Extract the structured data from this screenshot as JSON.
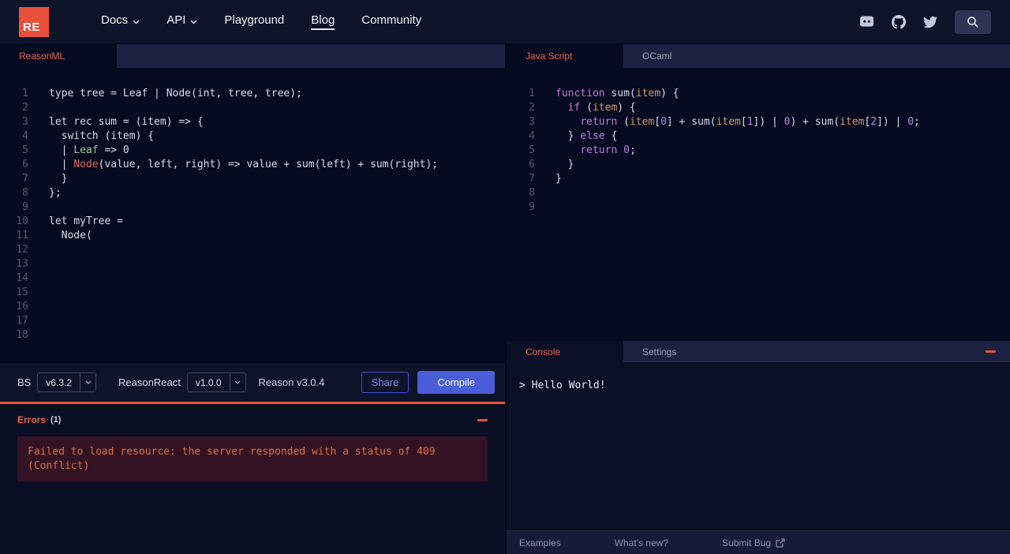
{
  "colors": {
    "accent_red": "#e8503a",
    "tab_red": "#e8604c",
    "button_blue": "#4a5dd8",
    "editor_bg": "#060a20"
  },
  "navbar": {
    "logo_text": "RE",
    "items": [
      {
        "label": "Docs",
        "has_caret": true
      },
      {
        "label": "API",
        "has_caret": true
      },
      {
        "label": "Playground",
        "has_caret": false
      },
      {
        "label": "Blog",
        "has_caret": false,
        "active": true
      },
      {
        "label": "Community",
        "has_caret": false
      }
    ],
    "icons": [
      "discord-icon",
      "github-icon",
      "twitter-icon",
      "search-icon"
    ]
  },
  "left_pane": {
    "tab": "ReasonML",
    "editor": {
      "line_count": 18,
      "lines": [
        [
          [
            "p",
            "type tree = Leaf | Node(int, tree, tree);"
          ]
        ],
        [],
        [
          [
            "p",
            "let rec sum = (item) => {"
          ]
        ],
        [
          [
            "p",
            "  switch (item) {"
          ]
        ],
        [
          [
            "p",
            "  | "
          ],
          [
            "g",
            "Leaf"
          ],
          [
            "p",
            " => 0"
          ]
        ],
        [
          [
            "p",
            "  | "
          ],
          [
            "r",
            "Node"
          ],
          [
            "p",
            "(value, left, right) => value + sum(left) + sum(right);"
          ]
        ],
        [
          [
            "p",
            "  }"
          ]
        ],
        [
          [
            "p",
            "};"
          ]
        ],
        [],
        [
          [
            "p",
            "let myTree ="
          ]
        ],
        [
          [
            "p",
            "  Node("
          ]
        ],
        [],
        [],
        [],
        [],
        [],
        [],
        []
      ]
    },
    "toolbar": {
      "bs_label": "BS",
      "bs_version": "v6.3.2",
      "reason_react_label": "ReasonReact",
      "reason_react_version": "v1.0.0",
      "reason_version_label": "Reason v3.0.4",
      "share_label": "Share",
      "compile_label": "Compile"
    },
    "errors": {
      "title": "Errors",
      "count": "(1)",
      "message": "Failed to load resource: the server responded with a status of 409 (Conflict)"
    }
  },
  "right_pane": {
    "tabs": [
      {
        "label": "Java Script",
        "active": true
      },
      {
        "label": "OCaml",
        "active": false
      }
    ],
    "editor": {
      "line_count": 9,
      "lines": [
        [
          [
            "k",
            "function"
          ],
          [
            "p",
            " sum("
          ],
          [
            "o",
            "item"
          ],
          [
            "p",
            ") {"
          ]
        ],
        [
          [
            "p",
            "  "
          ],
          [
            "k",
            "if"
          ],
          [
            "p",
            " ("
          ],
          [
            "o",
            "item"
          ],
          [
            "p",
            ") {"
          ]
        ],
        [
          [
            "p",
            "    "
          ],
          [
            "k",
            "return"
          ],
          [
            "p",
            " ("
          ],
          [
            "o",
            "item"
          ],
          [
            "p",
            "["
          ],
          [
            "n",
            "0"
          ],
          [
            "p",
            "] + sum("
          ],
          [
            "o",
            "item"
          ],
          [
            "p",
            "["
          ],
          [
            "n",
            "1"
          ],
          [
            "p",
            "]) | "
          ],
          [
            "n",
            "0"
          ],
          [
            "p",
            ") + sum("
          ],
          [
            "o",
            "item"
          ],
          [
            "p",
            "["
          ],
          [
            "n",
            "2"
          ],
          [
            "p",
            "]) | "
          ],
          [
            "n",
            "0"
          ],
          [
            "p",
            ";"
          ]
        ],
        [
          [
            "p",
            "  } "
          ],
          [
            "k",
            "else"
          ],
          [
            "p",
            " {"
          ]
        ],
        [
          [
            "p",
            "    "
          ],
          [
            "k",
            "return"
          ],
          [
            "p",
            " "
          ],
          [
            "n",
            "0"
          ],
          [
            "p",
            ";"
          ]
        ],
        [
          [
            "p",
            "  }"
          ]
        ],
        [
          [
            "p",
            "}"
          ]
        ],
        [],
        []
      ]
    },
    "console": {
      "tabs": [
        {
          "label": "Console",
          "active": true
        },
        {
          "label": "Settings",
          "active": false
        }
      ],
      "output": "> Hello World!"
    },
    "footer": {
      "links": [
        "Examples",
        "What's new?",
        "Submit Bug"
      ]
    }
  }
}
